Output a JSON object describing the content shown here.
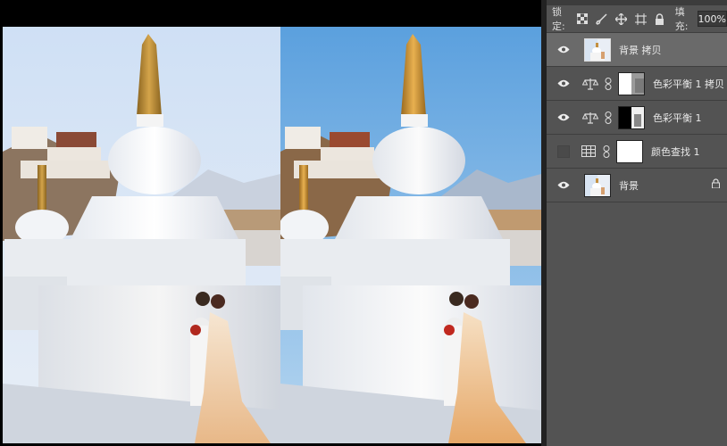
{
  "layers_panel": {
    "lock_label": "锁定:",
    "fill_label": "填充:",
    "fill_value": "100%",
    "lock_icons": [
      "lock-transparent-pixels-icon",
      "lock-image-pixels-icon",
      "lock-position-icon",
      "lock-artboard-icon",
      "lock-all-icon"
    ],
    "layers": [
      {
        "name": "背景 拷贝",
        "visible": true,
        "selected": true,
        "type": "pixel"
      },
      {
        "name": "色彩平衡 1 拷贝",
        "visible": true,
        "selected": false,
        "type": "color-balance",
        "mask": "grey-white"
      },
      {
        "name": "色彩平衡 1",
        "visible": true,
        "selected": false,
        "type": "color-balance",
        "mask": "black-white"
      },
      {
        "name": "颜色查找 1",
        "visible": false,
        "selected": false,
        "type": "color-lookup",
        "mask": "white"
      },
      {
        "name": "背景",
        "visible": true,
        "selected": false,
        "type": "pixel",
        "locked": true
      }
    ]
  },
  "colors": {
    "panel_bg": "#535353",
    "selected_layer": "#6a6a6a",
    "canvas_bg": "#000000"
  }
}
